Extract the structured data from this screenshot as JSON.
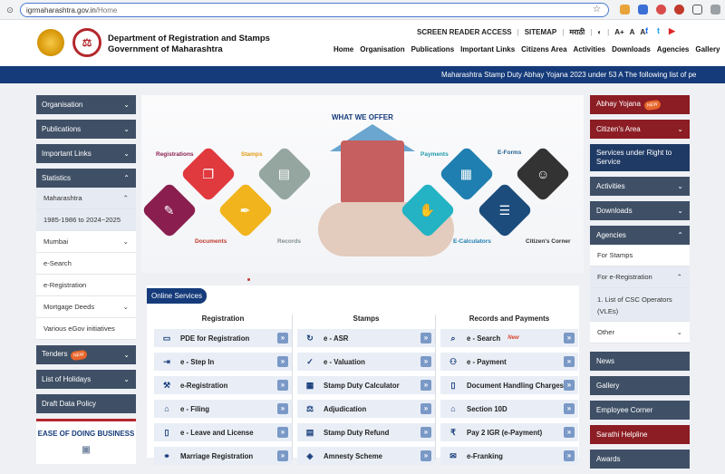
{
  "browser": {
    "url_host": "igrmaharashtra.gov.in",
    "url_path": "/Home"
  },
  "header": {
    "dept_line1": "Department of Registration and Stamps",
    "dept_line2": "Government of Maharashtra",
    "top_links": [
      "SCREEN READER ACCESS",
      "SITEMAP",
      "मराठी",
      "A+",
      "A",
      "A-"
    ],
    "nav": [
      "Home",
      "Organisation",
      "Publications",
      "Important Links",
      "Citizens Area",
      "Activities",
      "Downloads",
      "Agencies",
      "Gallery"
    ]
  },
  "ticker": "Maharashtra Stamp Duty Abhay Yojana 2023 under 53 A The following list of pe",
  "left_sidebar": {
    "organisation": "Organisation",
    "publications": "Publications",
    "important_links": "Important Links",
    "statistics": "Statistics",
    "stats_items": [
      "Maharashtra",
      "1985-1986 to 2024~2025",
      "Mumbai",
      "e-Search",
      "e-Registration",
      "Mortgage Deeds",
      "Various eGov initiatives"
    ],
    "tenders": "Tenders",
    "new_badge": "NEW",
    "holidays": "List of Holidays",
    "draft": "Draft Data Policy",
    "ease": "EASE OF DOING BUSINESS"
  },
  "hero": {
    "title": "WHAT WE OFFER",
    "labels": [
      "Registrations",
      "Stamps",
      "Documents",
      "Records",
      "Payments",
      "E-Forms",
      "E-Calculators",
      "Citizen's Corner"
    ]
  },
  "services": {
    "tab": "Online Services",
    "columns": [
      {
        "head": "Registration",
        "items": [
          "PDE for Registration",
          "e - Step In",
          "e-Registration",
          "e - Filing",
          "e - Leave and License",
          "Marriage Registration"
        ]
      },
      {
        "head": "Stamps",
        "items": [
          "e - ASR",
          "e - Valuation",
          "Stamp Duty Calculator",
          "Adjudication",
          "Stamp Duty Refund",
          "Amnesty Scheme"
        ]
      },
      {
        "head": "Records and Payments",
        "items": [
          "e - Search",
          "e - Payment",
          "Document Handling Charges",
          "Section 10D",
          "Pay 2 IGR (e-Payment)",
          "e-Franking"
        ]
      }
    ],
    "new_label": "New"
  },
  "right_sidebar": {
    "abhay": "Abhay Yojana",
    "citizens": "Citizen's Area",
    "rts": "Services under Right to Service",
    "activities": "Activities",
    "downloads": "Downloads",
    "agencies": "Agencies",
    "agency_items": [
      "For Stamps",
      "For e-Registration",
      "1. List of CSC Operators (VLEs)",
      "Other"
    ],
    "news": "News",
    "gallery": "Gallery",
    "employee": "Employee Corner",
    "sarathi": "Sarathi Helpline",
    "awards": "Awards"
  }
}
